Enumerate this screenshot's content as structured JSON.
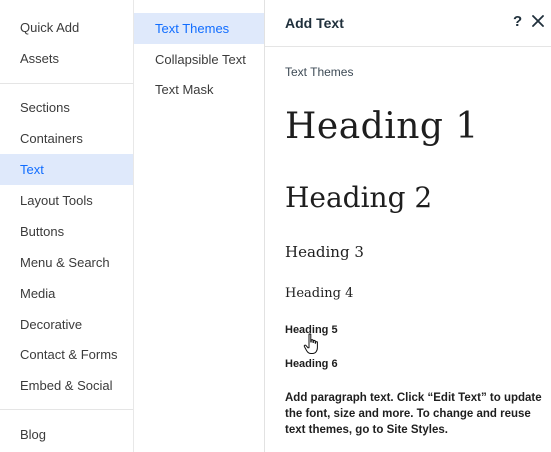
{
  "left_nav": {
    "items": [
      {
        "label": "Quick Add"
      },
      {
        "label": "Assets"
      },
      {
        "label": "Sections"
      },
      {
        "label": "Containers"
      },
      {
        "label": "Text",
        "active": true
      },
      {
        "label": "Layout Tools"
      },
      {
        "label": "Buttons"
      },
      {
        "label": "Menu & Search"
      },
      {
        "label": "Media"
      },
      {
        "label": "Decorative"
      },
      {
        "label": "Contact & Forms"
      },
      {
        "label": "Embed & Social"
      },
      {
        "label": "Blog"
      }
    ]
  },
  "sub_nav": {
    "items": [
      {
        "label": "Text Themes",
        "active": true
      },
      {
        "label": "Collapsible Text"
      },
      {
        "label": "Text Mask"
      }
    ]
  },
  "panel": {
    "title": "Add Text",
    "help": "?",
    "section_label": "Text Themes",
    "themes": {
      "h1": "Heading 1",
      "h2": "Heading 2",
      "h3": "Heading 3",
      "h4": "Heading 4",
      "h5": "Heading 5",
      "h6": "Heading 6",
      "paragraph": "Add paragraph text. Click “Edit Text” to update the font, size and more. To change and reuse text themes, go to Site Styles."
    }
  },
  "icons": {
    "close": "close-icon",
    "cursor": "hand-pointer-icon"
  },
  "colors": {
    "accent": "#116dff",
    "active_bg": "#dfe9fb",
    "text": "#3b3b3b",
    "heading_text": "#20303c"
  }
}
